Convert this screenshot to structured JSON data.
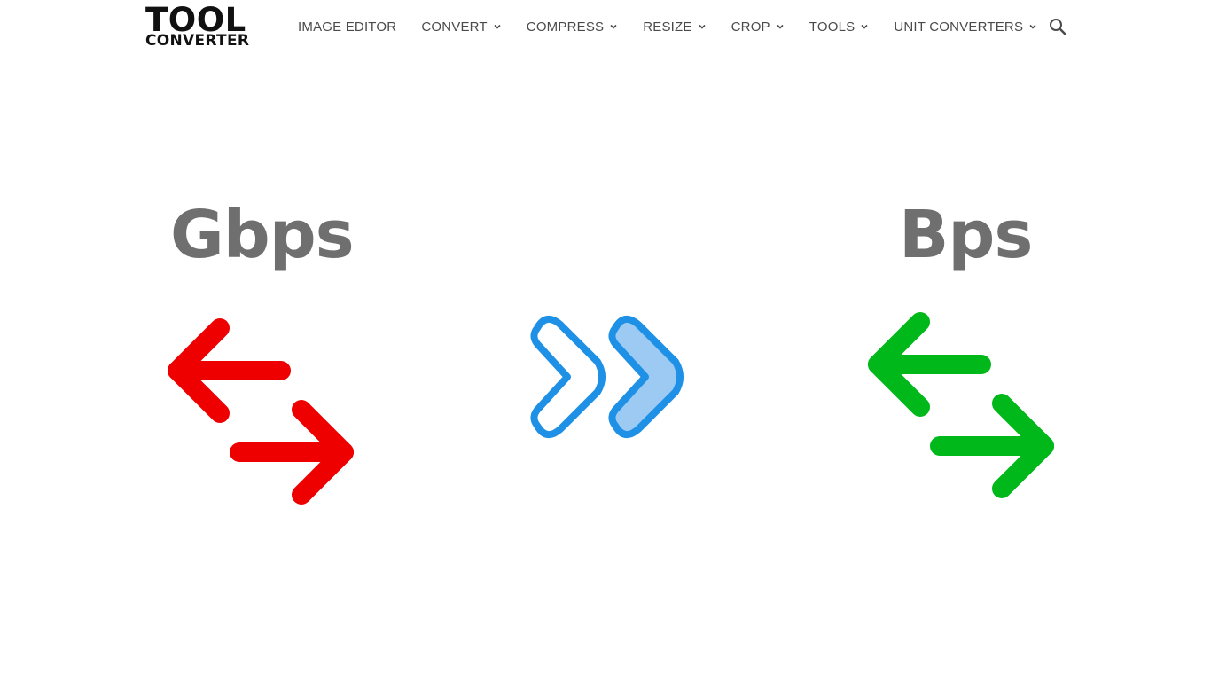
{
  "logo": {
    "line1": "TOOL",
    "line2": "CONVERTER"
  },
  "nav": {
    "items": [
      {
        "label": "IMAGE EDITOR",
        "has_dropdown": false
      },
      {
        "label": "CONVERT",
        "has_dropdown": true
      },
      {
        "label": "COMPRESS",
        "has_dropdown": true
      },
      {
        "label": "RESIZE",
        "has_dropdown": true
      },
      {
        "label": "CROP",
        "has_dropdown": true
      },
      {
        "label": "TOOLS",
        "has_dropdown": true
      },
      {
        "label": "UNIT CONVERTERS",
        "has_dropdown": true
      }
    ],
    "search_icon": "search-icon"
  },
  "hero": {
    "from_unit": "Gbps",
    "to_unit": "Bps",
    "from_icon": "swap-arrows-icon",
    "middle_icon": "double-chevron-right-icon",
    "to_icon": "swap-arrows-icon",
    "colors": {
      "from": "#ee0000",
      "middle_stroke": "#1e90e6",
      "middle_fill": "#9ccaf2",
      "to": "#00b81a",
      "unit_text": "#6f6f6f"
    }
  }
}
